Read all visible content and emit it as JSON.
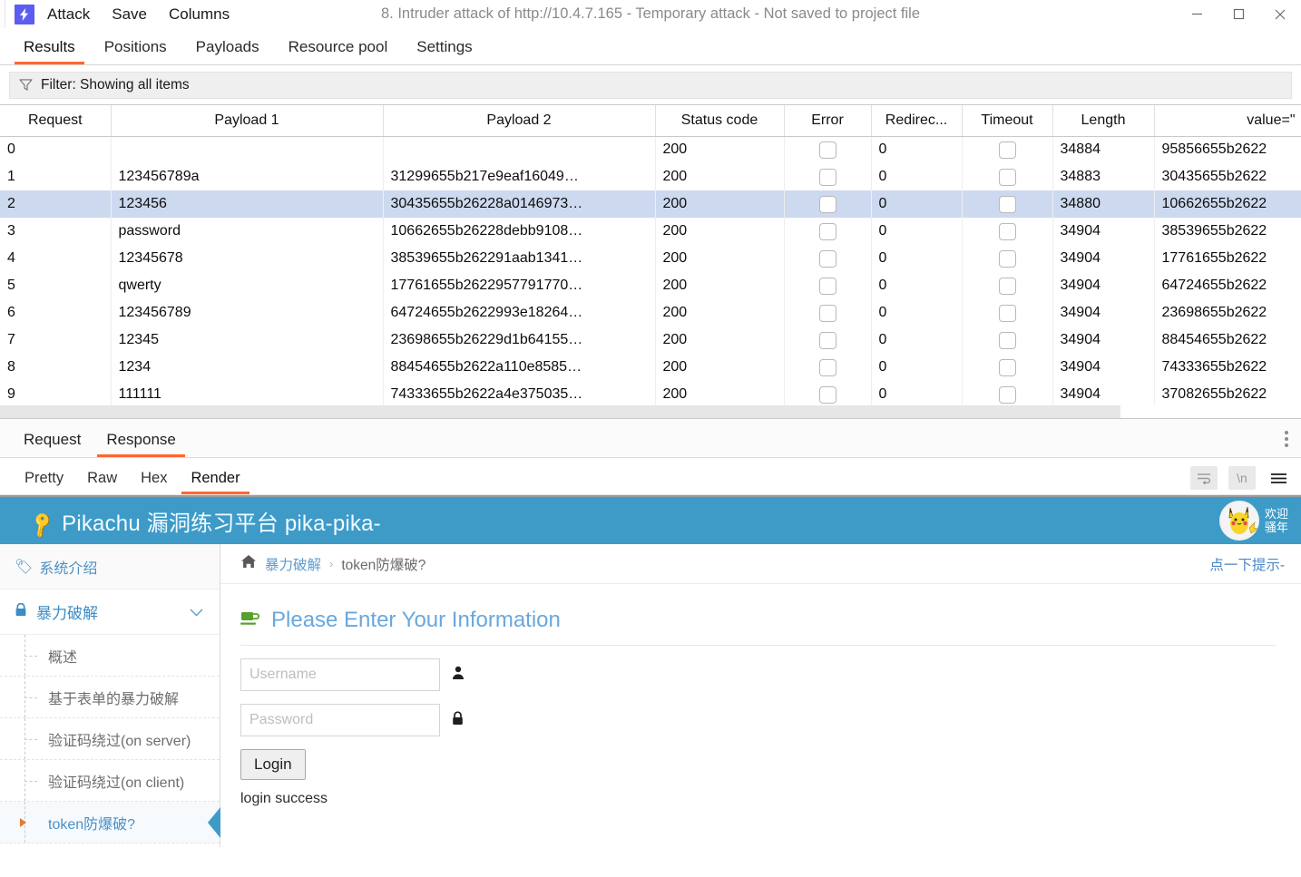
{
  "titlebar": {
    "logo_icon": "burp-lightning-icon",
    "menu": [
      "Attack",
      "Save",
      "Columns"
    ],
    "title": "8. Intruder attack of http://10.4.7.165 - Temporary attack - Not saved to project file",
    "minimize": "minimize-icon",
    "maximize": "maximize-icon",
    "close": "close-icon"
  },
  "toptabs": {
    "items": [
      "Results",
      "Positions",
      "Payloads",
      "Resource pool",
      "Settings"
    ],
    "active": "Results",
    "accent": "#ff6633"
  },
  "filter": {
    "icon": "funnel-icon",
    "label": "Filter: Showing all items"
  },
  "table": {
    "columns": [
      "Request",
      "Payload 1",
      "Payload 2",
      "Status code",
      "Error",
      "Redirec...",
      "Timeout",
      "Length",
      "value=\""
    ],
    "selected_row_index": 2,
    "rows": [
      {
        "request": "0",
        "payload1": "",
        "payload2": "",
        "status": "200",
        "error": false,
        "redirect": "0",
        "timeout": false,
        "length": "34884",
        "value": "95856655b2622"
      },
      {
        "request": "1",
        "payload1": "123456789a",
        "payload2": "31299655b217e9eaf16049…",
        "status": "200",
        "error": false,
        "redirect": "0",
        "timeout": false,
        "length": "34883",
        "value": "30435655b2622"
      },
      {
        "request": "2",
        "payload1": "123456",
        "payload2": "30435655b26228a0146973…",
        "status": "200",
        "error": false,
        "redirect": "0",
        "timeout": false,
        "length": "34880",
        "value": "10662655b2622"
      },
      {
        "request": "3",
        "payload1": "password",
        "payload2": "10662655b26228debb9108…",
        "status": "200",
        "error": false,
        "redirect": "0",
        "timeout": false,
        "length": "34904",
        "value": "38539655b2622"
      },
      {
        "request": "4",
        "payload1": "12345678",
        "payload2": "38539655b262291aab1341…",
        "status": "200",
        "error": false,
        "redirect": "0",
        "timeout": false,
        "length": "34904",
        "value": "17761655b2622"
      },
      {
        "request": "5",
        "payload1": "qwerty",
        "payload2": "17761655b2622957791770…",
        "status": "200",
        "error": false,
        "redirect": "0",
        "timeout": false,
        "length": "34904",
        "value": "64724655b2622"
      },
      {
        "request": "6",
        "payload1": "123456789",
        "payload2": "64724655b2622993e18264…",
        "status": "200",
        "error": false,
        "redirect": "0",
        "timeout": false,
        "length": "34904",
        "value": "23698655b2622"
      },
      {
        "request": "7",
        "payload1": "12345",
        "payload2": "23698655b26229d1b64155…",
        "status": "200",
        "error": false,
        "redirect": "0",
        "timeout": false,
        "length": "34904",
        "value": "88454655b2622"
      },
      {
        "request": "8",
        "payload1": "1234",
        "payload2": "88454655b2622a110e8585…",
        "status": "200",
        "error": false,
        "redirect": "0",
        "timeout": false,
        "length": "34904",
        "value": "74333655b2622"
      },
      {
        "request": "9",
        "payload1": "111111",
        "payload2": "74333655b2622a4e375035…",
        "status": "200",
        "error": false,
        "redirect": "0",
        "timeout": false,
        "length": "34904",
        "value": "37082655b2622"
      }
    ]
  },
  "message_tabs": {
    "items": [
      "Request",
      "Response"
    ],
    "active": "Response",
    "kebab": "more-options-icon"
  },
  "view_tabs": {
    "items": [
      "Pretty",
      "Raw",
      "Hex",
      "Render"
    ],
    "active": "Render",
    "tools": [
      "word-wrap-icon",
      "show-newlines-icon",
      "menu-icon"
    ]
  },
  "rendered_page": {
    "header": {
      "key_icon": "key-icon",
      "title": "Pikachu 漏洞练习平台 pika-pika-",
      "avatar_icon": "pikachu-avatar-icon",
      "welcome_line1": "欢迎",
      "welcome_line2": "骚年",
      "bg": "#3e9bc8"
    },
    "sidebar": {
      "intro": {
        "icon": "tag-icon",
        "label": "系统介绍"
      },
      "group": {
        "icon": "lock-icon",
        "label": "暴力破解",
        "caret": "chevron-down-icon"
      },
      "items": [
        {
          "label": "概述",
          "active": false
        },
        {
          "label": "基于表单的暴力破解",
          "active": false
        },
        {
          "label": "验证码绕过(on server)",
          "active": false
        },
        {
          "label": "验证码绕过(on client)",
          "active": false
        },
        {
          "label": "token防爆破?",
          "active": true
        }
      ]
    },
    "breadcrumb": {
      "home_icon": "home-icon",
      "parent": "暴力破解",
      "separator": "›",
      "current": "token防爆破?",
      "hint": "点一下提示-"
    },
    "form": {
      "icon": "coffee-cup-icon",
      "title": "Please Enter Your Information",
      "username_placeholder": "Username",
      "username_value": "",
      "username_icon": "user-icon",
      "password_placeholder": "Password",
      "password_value": "",
      "password_icon": "lock-icon",
      "login_label": "Login",
      "message": "login success"
    }
  }
}
